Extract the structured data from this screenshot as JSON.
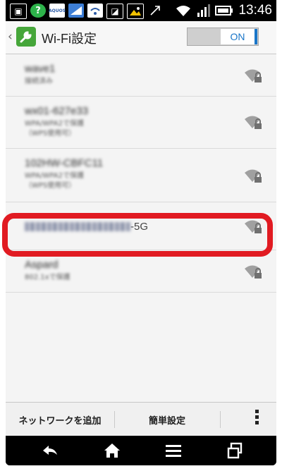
{
  "statusbar": {
    "left_icons": [
      "picture-icon",
      "ai-assistant-icon",
      "aquos-icon",
      "signal-app-icon",
      "wifi-app-icon",
      "image-bell-icon",
      "mountain-photo-icon",
      "bluetooth-outline-icon"
    ],
    "aquos_label": "AQUOS",
    "time": "13:46"
  },
  "appbar": {
    "title": "Wi-Fi設定",
    "toggle_label": "ON",
    "toggle_on": true,
    "accent": "#1a76c8",
    "icon_color": "#46a63a"
  },
  "networks": [
    {
      "name": "wave1",
      "sub": "接続済み",
      "sub2": ""
    },
    {
      "name": "wx01-627e33",
      "sub": "WPA/WPA2で保護",
      "sub2": "（WPS使用可）"
    },
    {
      "name": "102HW-CBFC11",
      "sub": "WPA/WPA2で保護",
      "sub2": "（WPS使用可）"
    },
    {
      "name_suffix": "-5G",
      "sub": ""
    },
    {
      "name": "Aspard",
      "sub": "802.1xで保護",
      "sub2": ""
    }
  ],
  "highlight_color": "#e11b22",
  "actionbar": {
    "add_network": "ネットワークを追加",
    "easy_setup": "簡単設定",
    "overflow_icon": "overflow-menu-icon"
  },
  "navbar": [
    "back-icon",
    "home-icon",
    "menu-icon",
    "recent-apps-icon"
  ]
}
